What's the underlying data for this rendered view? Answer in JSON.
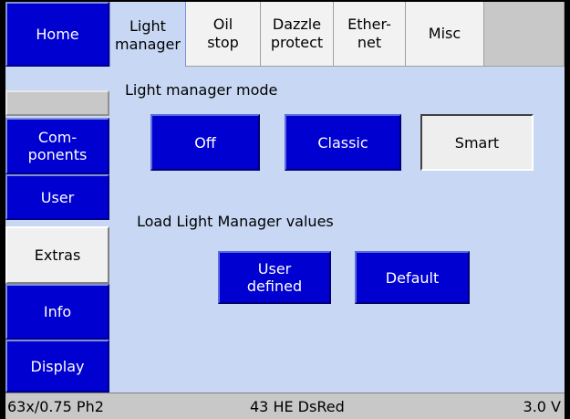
{
  "sidebar": {
    "items": [
      {
        "label": "Home"
      },
      {
        "label": ""
      },
      {
        "label": "Com-\nponents"
      },
      {
        "label": "User"
      },
      {
        "label": "Extras"
      },
      {
        "label": "Info"
      },
      {
        "label": "Display"
      }
    ]
  },
  "tabs": [
    {
      "label": "Light\nmanager",
      "active": true
    },
    {
      "label": "Oil\nstop",
      "active": false
    },
    {
      "label": "Dazzle\nprotect",
      "active": false
    },
    {
      "label": "Ether-\nnet",
      "active": false
    },
    {
      "label": "Misc",
      "active": false
    },
    {
      "label": "",
      "active": false
    }
  ],
  "content": {
    "mode_label": "Light manager mode",
    "mode_buttons": {
      "off": "Off",
      "classic": "Classic",
      "smart": "Smart"
    },
    "selected_mode": "Smart",
    "load_label": "Load Light Manager values",
    "load_buttons": {
      "user_defined": "User\ndefined",
      "default": "Default"
    }
  },
  "status": {
    "objective": "63x/0.75 Ph2",
    "filter": "43 HE DsRed",
    "voltage": "3.0 V"
  },
  "colors": {
    "blue_button": "#0000d0",
    "panel_background": "#c8d8f4",
    "selected_button": "#eeeeee",
    "status_bar": "#c8c8c8"
  }
}
